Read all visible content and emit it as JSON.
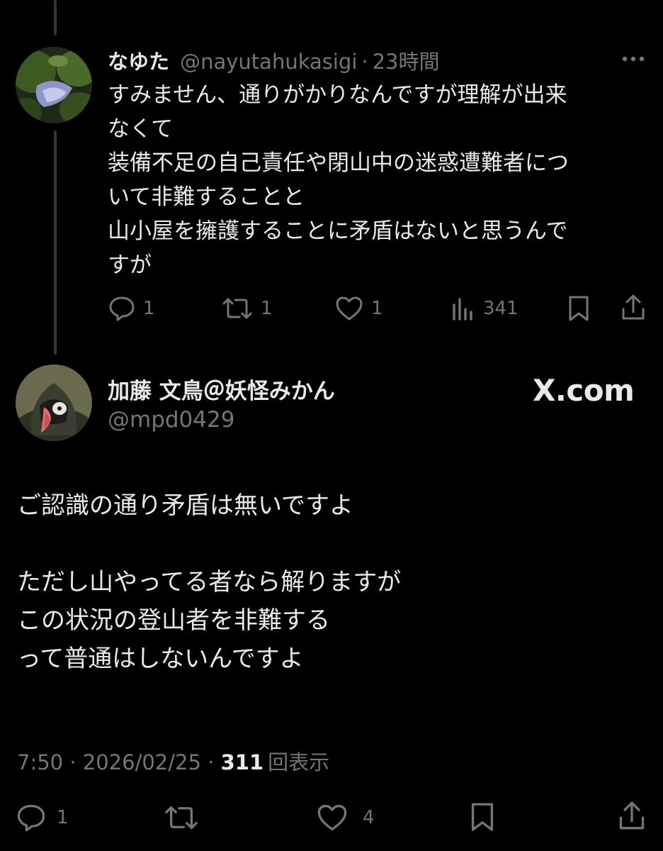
{
  "reply": {
    "display_name": "なゆた",
    "handle": "@nayutahukasigi",
    "separator": "·",
    "time": "23時間",
    "body": "すみません、通りがかりなんですが理解が出来\nなくて\n装備不足の自己責任や閉山中の迷惑遭難者につ\nいて非難することと\n山小屋を擁護することに矛盾はないと思うんで\nすが",
    "actions": {
      "replies": "1",
      "reposts": "1",
      "likes": "1",
      "views": "341"
    }
  },
  "main": {
    "display_name": "加藤 文鳥＠妖怪みかん",
    "handle": "@mpd0429",
    "watermark": "X.com",
    "body": "ご認識の通り矛盾は無いですよ\n\nただし山やってる者なら解りますが\nこの状況の登山者を非難する\nって普通はしないんですよ",
    "timestamp_time": "7:50",
    "sep1": " · ",
    "timestamp_date": "2026/02/25",
    "sep2": " · ",
    "views_count": "311",
    "views_label": "回表示",
    "actions": {
      "replies": "1",
      "likes": "4"
    }
  },
  "icons": {
    "reply": "reply-icon",
    "repost": "repost-icon",
    "like": "heart-icon",
    "views": "views-chart-icon",
    "bookmark": "bookmark-icon",
    "share": "share-icon",
    "more": "more-icon"
  }
}
